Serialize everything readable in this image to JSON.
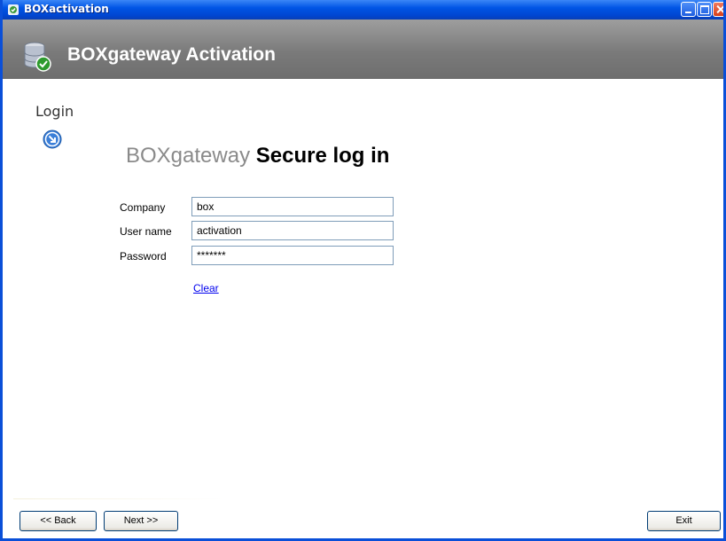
{
  "window": {
    "title": "BOXactivation",
    "controls": [
      "minimize",
      "maximize",
      "close"
    ]
  },
  "header": {
    "title": "BOXgateway Activation",
    "icon": "database-check-icon"
  },
  "step": {
    "label": "Login",
    "icon": "arrow-down-right-circle-icon"
  },
  "heading": {
    "prefix": "BOXgateway",
    "main": "Secure log in"
  },
  "form": {
    "company": {
      "label": "Company",
      "value": "box"
    },
    "username": {
      "label": "User name",
      "value": "activation"
    },
    "password": {
      "label": "Password",
      "value": "*******"
    },
    "clear_link": "Clear"
  },
  "buttons": {
    "back": "<< Back",
    "next": "Next >>",
    "exit": "Exit"
  },
  "colors": {
    "titlebar": "#0055e5",
    "header_bg": "#808080",
    "link": "#0000ee"
  }
}
